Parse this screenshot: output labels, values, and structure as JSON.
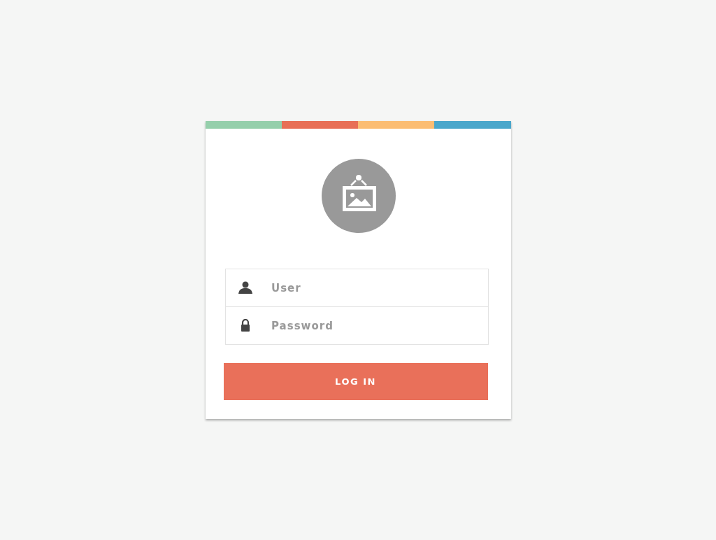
{
  "fields": [
    {
      "kind": "user",
      "placeholder": "User"
    },
    {
      "kind": "password",
      "placeholder": "Password"
    }
  ],
  "button": "LOG IN"
}
